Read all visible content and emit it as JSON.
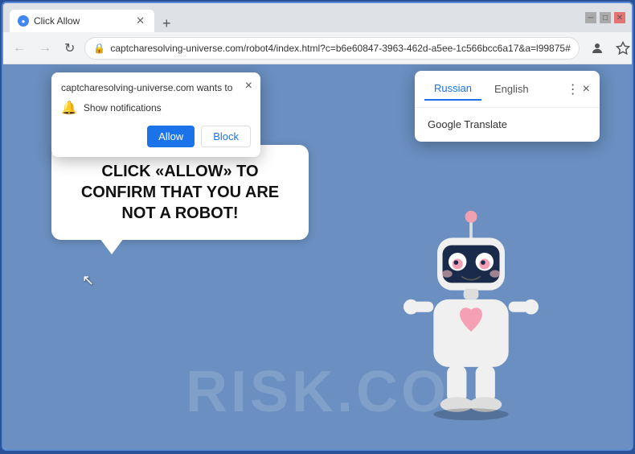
{
  "window": {
    "title": "Click Allow",
    "url": "captcharesolving-universe.com/robot4/index.html?c=b6e60847-3963-462d-a5ee-1c566bcc6a17&a=l99875#",
    "tab_label": "Click Allow",
    "new_tab_label": "+"
  },
  "nav": {
    "back_label": "←",
    "forward_label": "→",
    "reload_label": "↻"
  },
  "notification": {
    "site_text": "captcharesolving-universe.com wants to",
    "close_label": "×",
    "row_label": "Show notifications",
    "allow_label": "Allow",
    "block_label": "Block"
  },
  "translate": {
    "tab_russian": "Russian",
    "tab_english": "English",
    "service_label": "Google Translate",
    "close_label": "×",
    "menu_label": "⋮"
  },
  "message": {
    "text": "CLICK «ALLOW» TO CONFIRM THAT YOU ARE NOT A ROBOT!"
  },
  "watermark": {
    "text": "RISK.CO"
  },
  "address_icons": {
    "lock": "🔒",
    "star": "☆",
    "profile": "👤",
    "dots": "⋮"
  }
}
